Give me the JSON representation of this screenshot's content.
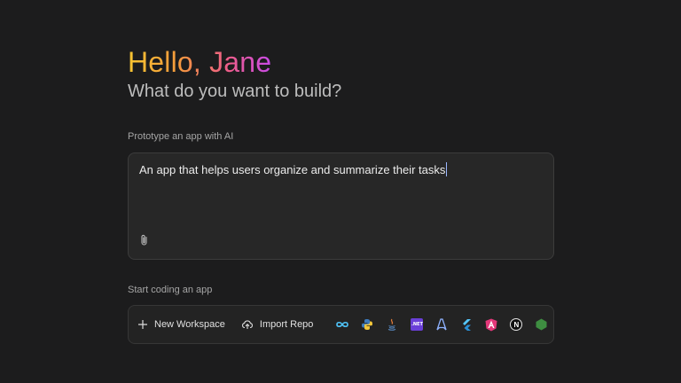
{
  "header": {
    "greeting": "Hello, Jane",
    "subtitle": "What do you want to build?"
  },
  "prototype": {
    "label": "Prototype an app with AI",
    "input_value": "An app that helps users organize and summarize their tasks"
  },
  "coding": {
    "label": "Start coding an app",
    "new_workspace_label": "New Workspace",
    "import_repo_label": "Import Repo",
    "templates": [
      {
        "name": "infinity-icon",
        "color": "#4fc3f7"
      },
      {
        "name": "python-icon",
        "color": "#3d7bbf"
      },
      {
        "name": "java-icon",
        "color": "#e07b39"
      },
      {
        "name": "dotnet-icon",
        "color": "#6a3fd8",
        "text": ".NET"
      },
      {
        "name": "astro-icon",
        "color": "#8fb2ff"
      },
      {
        "name": "flutter-icon",
        "color": "#55c5f8"
      },
      {
        "name": "angular-icon",
        "color": "#e4387a"
      },
      {
        "name": "nextjs-icon",
        "color": "#ffffff",
        "text": "N"
      },
      {
        "name": "nodejs-icon",
        "color": "#3e8e41"
      }
    ]
  },
  "colors": {
    "background": "#1c1c1d",
    "gradient": [
      "#f7c531",
      "#f59a3c",
      "#ee5d8a",
      "#c84ae8"
    ],
    "caret": "#9ab6ff"
  }
}
